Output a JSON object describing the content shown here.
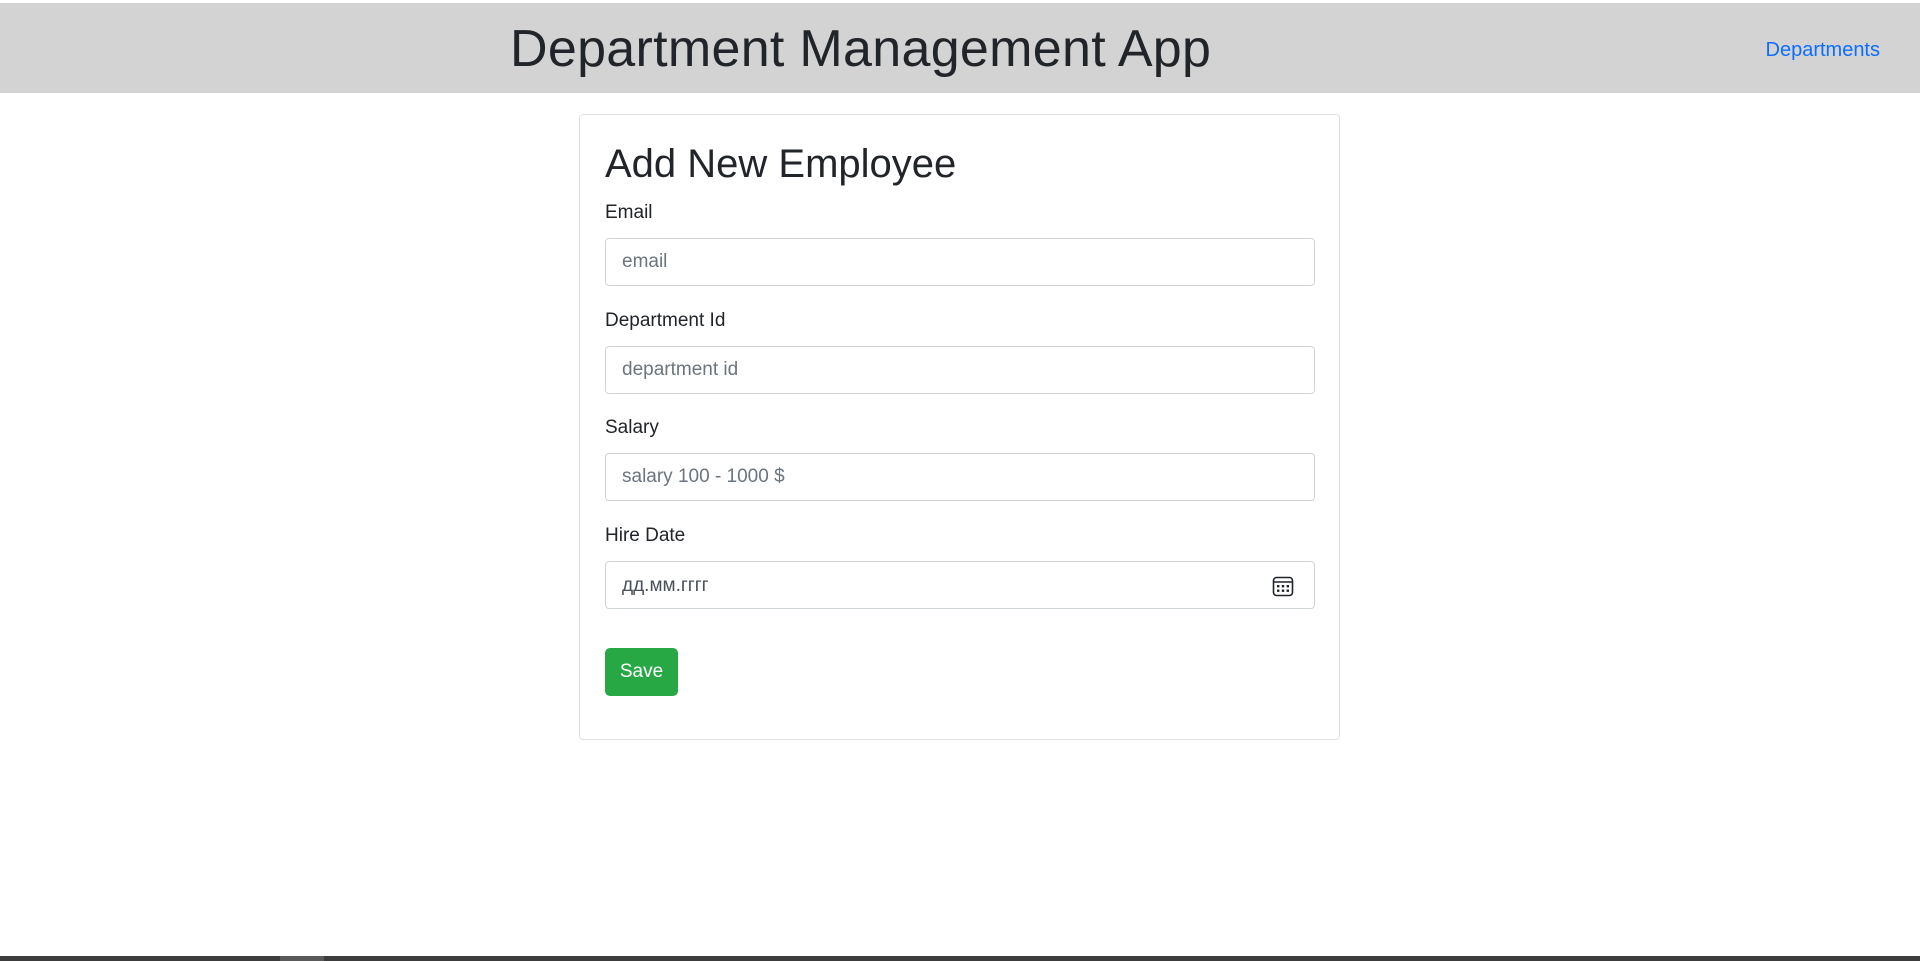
{
  "header": {
    "title": "Department Management App",
    "nav_link": "Departments",
    "background": "#d3d3d3",
    "link_color": "#0d6efd"
  },
  "form": {
    "title": "Add New Employee",
    "fields": [
      {
        "label": "Email",
        "placeholder": "email",
        "value": ""
      },
      {
        "label": "Department Id",
        "placeholder": "department id",
        "value": ""
      },
      {
        "label": "Salary",
        "placeholder": "salary 100 - 1000 $",
        "value": ""
      },
      {
        "label": "Hire Date",
        "placeholder": "дд.мм.гггг",
        "value": "",
        "icon": "calendar-icon"
      }
    ],
    "save_label": "Save",
    "save_color": "#28a745"
  }
}
